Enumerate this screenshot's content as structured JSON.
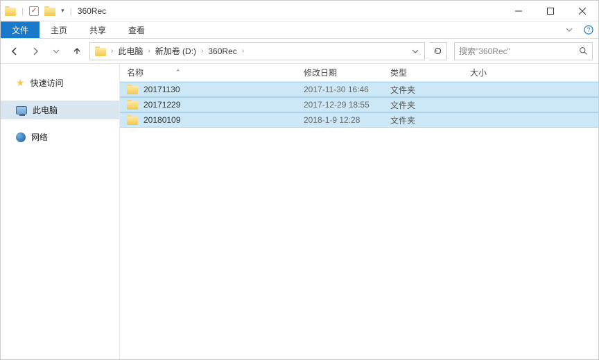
{
  "window": {
    "title": "360Rec"
  },
  "ribbon": {
    "file": "文件",
    "tabs": [
      "主页",
      "共享",
      "查看"
    ]
  },
  "nav": {
    "crumbs": [
      "此电脑",
      "新加卷 (D:)",
      "360Rec"
    ],
    "search_placeholder": "搜索\"360Rec\""
  },
  "sidebar": {
    "quick": "快速访问",
    "thispc": "此电脑",
    "network": "网络"
  },
  "columns": {
    "name": "名称",
    "date": "修改日期",
    "type": "类型",
    "size": "大小"
  },
  "rows": [
    {
      "name": "20171130",
      "date": "2017-11-30 16:46",
      "type": "文件夹",
      "selected": true
    },
    {
      "name": "20171229",
      "date": "2017-12-29 18:55",
      "type": "文件夹",
      "selected": true
    },
    {
      "name": "20180109",
      "date": "2018-1-9 12:28",
      "type": "文件夹",
      "selected": true
    }
  ]
}
